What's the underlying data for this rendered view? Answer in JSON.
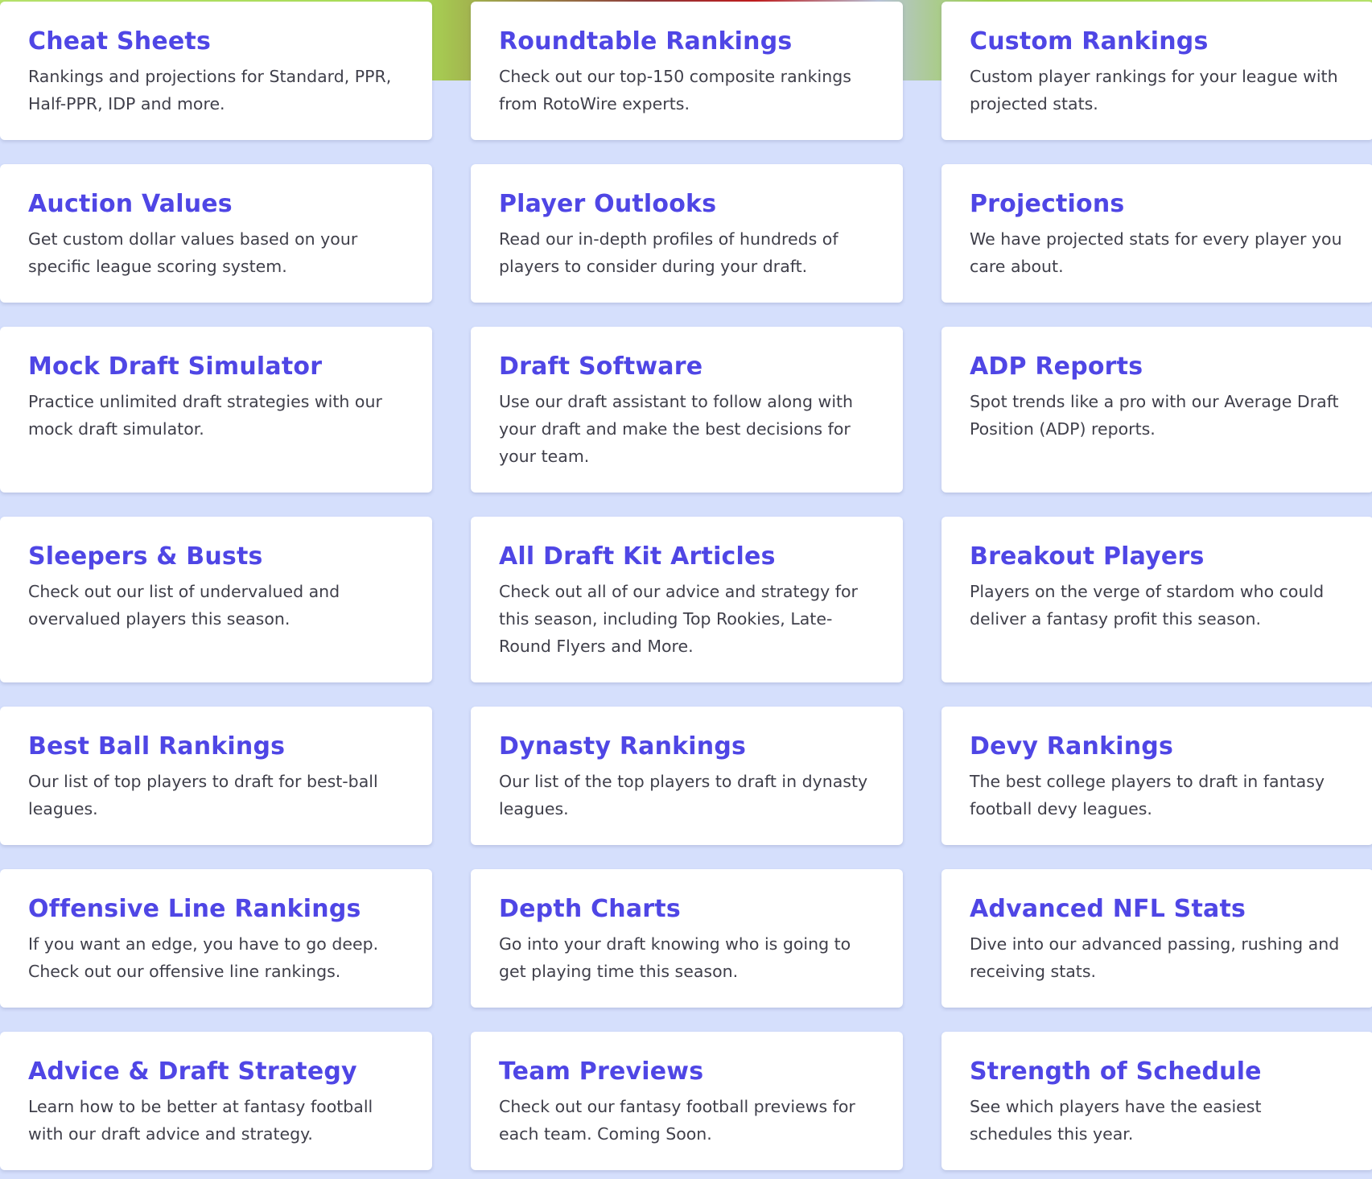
{
  "colors": {
    "background": "#d5dffc",
    "card": "#ffffff",
    "title": "#4f46e5",
    "text": "#3f3f4a"
  },
  "cards": [
    {
      "title": "Cheat Sheets",
      "desc": "Rankings and projections for Standard, PPR, Half-PPR, IDP and more."
    },
    {
      "title": "Roundtable Rankings",
      "desc": "Check out our top-150 composite rankings from RotoWire experts."
    },
    {
      "title": "Custom Rankings",
      "desc": "Custom player rankings for your league with projected stats."
    },
    {
      "title": "Auction Values",
      "desc": "Get custom dollar values based on your specific league scoring system."
    },
    {
      "title": "Player Outlooks",
      "desc": "Read our in-depth profiles of hundreds of players to consider during your draft."
    },
    {
      "title": "Projections",
      "desc": "We have projected stats for every player you care about."
    },
    {
      "title": "Mock Draft Simulator",
      "desc": "Practice unlimited draft strategies with our mock draft simulator."
    },
    {
      "title": "Draft Software",
      "desc": "Use our draft assistant to follow along with your draft and make the best decisions for your team."
    },
    {
      "title": "ADP Reports",
      "desc": "Spot trends like a pro with our Average Draft Position (ADP) reports."
    },
    {
      "title": "Sleepers & Busts",
      "desc": "Check out our list of undervalued and overvalued players this season."
    },
    {
      "title": "All Draft Kit Articles",
      "desc": "Check out all of our advice and strategy for this season, including Top Rookies, Late-Round Flyers and More."
    },
    {
      "title": "Breakout Players",
      "desc": "Players on the verge of stardom who could deliver a fantasy profit this season."
    },
    {
      "title": "Best Ball Rankings",
      "desc": "Our list of top players to draft for best-ball leagues."
    },
    {
      "title": "Dynasty Rankings",
      "desc": "Our list of the top players to draft in dynasty leagues."
    },
    {
      "title": "Devy Rankings",
      "desc": "The best college players to draft in fantasy football devy leagues."
    },
    {
      "title": "Offensive Line Rankings",
      "desc": "If you want an edge, you have to go deep. Check out our offensive line rankings."
    },
    {
      "title": "Depth Charts",
      "desc": "Go into your draft knowing who is going to get playing time this season."
    },
    {
      "title": "Advanced NFL Stats",
      "desc": "Dive into our advanced passing, rushing and receiving stats."
    },
    {
      "title": "Advice & Draft Strategy",
      "desc": "Learn how to be better at fantasy football with our draft advice and strategy."
    },
    {
      "title": "Team Previews",
      "desc": "Check out our fantasy football previews for each team. Coming Soon."
    },
    {
      "title": "Strength of Schedule",
      "desc": "See which players have the easiest schedules this year."
    }
  ]
}
